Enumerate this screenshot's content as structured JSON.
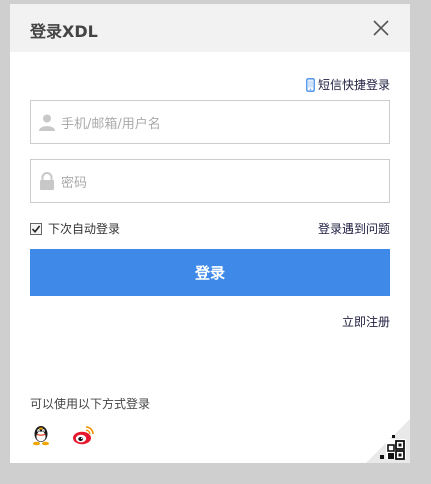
{
  "dialog": {
    "title": "登录XDL",
    "sms_login_label": "短信快捷登录",
    "username_placeholder": "手机/邮箱/用户名",
    "password_placeholder": "密码",
    "remember_label": "下次自动登录",
    "remember_checked": true,
    "help_label": "登录遇到问题",
    "login_button_label": "登录",
    "register_label": "立即注册",
    "other_methods_label": "可以使用以下方式登录"
  },
  "icons": {
    "close": "close-icon",
    "sms": "phone-icon",
    "user": "user-icon",
    "lock": "lock-icon",
    "qq": "qq-icon",
    "weibo": "weibo-icon",
    "qr": "qr-code-icon"
  },
  "colors": {
    "accent": "#3f8ae8",
    "link": "#222244",
    "backdrop": "#cfcfcf",
    "header_bg": "#f2f2f2"
  }
}
